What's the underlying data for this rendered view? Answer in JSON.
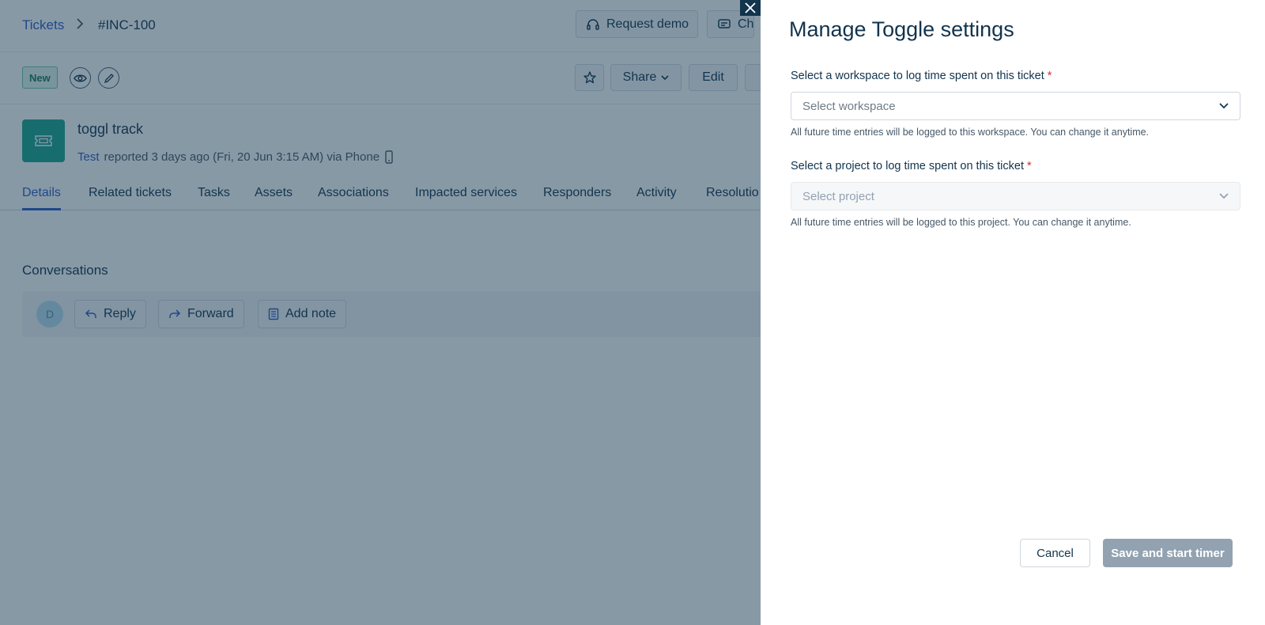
{
  "header": {
    "breadcrumb_link": "Tickets",
    "breadcrumb_current": "#INC-100",
    "request_demo_label": "Request demo",
    "chat_label": "Cha"
  },
  "toolbar": {
    "status_badge": "New",
    "share_label": "Share",
    "edit_label": "Edit"
  },
  "ticket": {
    "title": "toggl track",
    "reporter": "Test",
    "reported_text": "reported 3 days ago (Fri, 20 Jun 3:15 AM) via Phone"
  },
  "tabs": [
    {
      "label": "Details",
      "active": true
    },
    {
      "label": "Related tickets"
    },
    {
      "label": "Tasks"
    },
    {
      "label": "Assets"
    },
    {
      "label": "Associations"
    },
    {
      "label": "Impacted services"
    },
    {
      "label": "Responders"
    },
    {
      "label": "Activity"
    },
    {
      "label": "Resolutio"
    }
  ],
  "conversations": {
    "title": "Conversations",
    "avatar_initial": "D",
    "reply_label": "Reply",
    "forward_label": "Forward",
    "add_note_label": "Add note"
  },
  "drawer": {
    "title": "Manage Toggle settings",
    "workspace": {
      "label": "Select a workspace to log time spent on this ticket",
      "required_mark": "*",
      "placeholder": "Select workspace",
      "helper": "All future time entries will be logged to this workspace. You can change it anytime."
    },
    "project": {
      "label": "Select a project to log time spent on this ticket",
      "required_mark": "*",
      "placeholder": "Select project",
      "helper": "All future time entries will be logged to this project. You can change it anytime."
    },
    "cancel_label": "Cancel",
    "save_label": "Save and start timer"
  },
  "colors": {
    "link_blue": "#2c5cc5",
    "ticket_icon_green": "#1da58e",
    "overlay": "#12344d",
    "disabled_button": "#92a2b1",
    "required_red": "#d72d30"
  }
}
